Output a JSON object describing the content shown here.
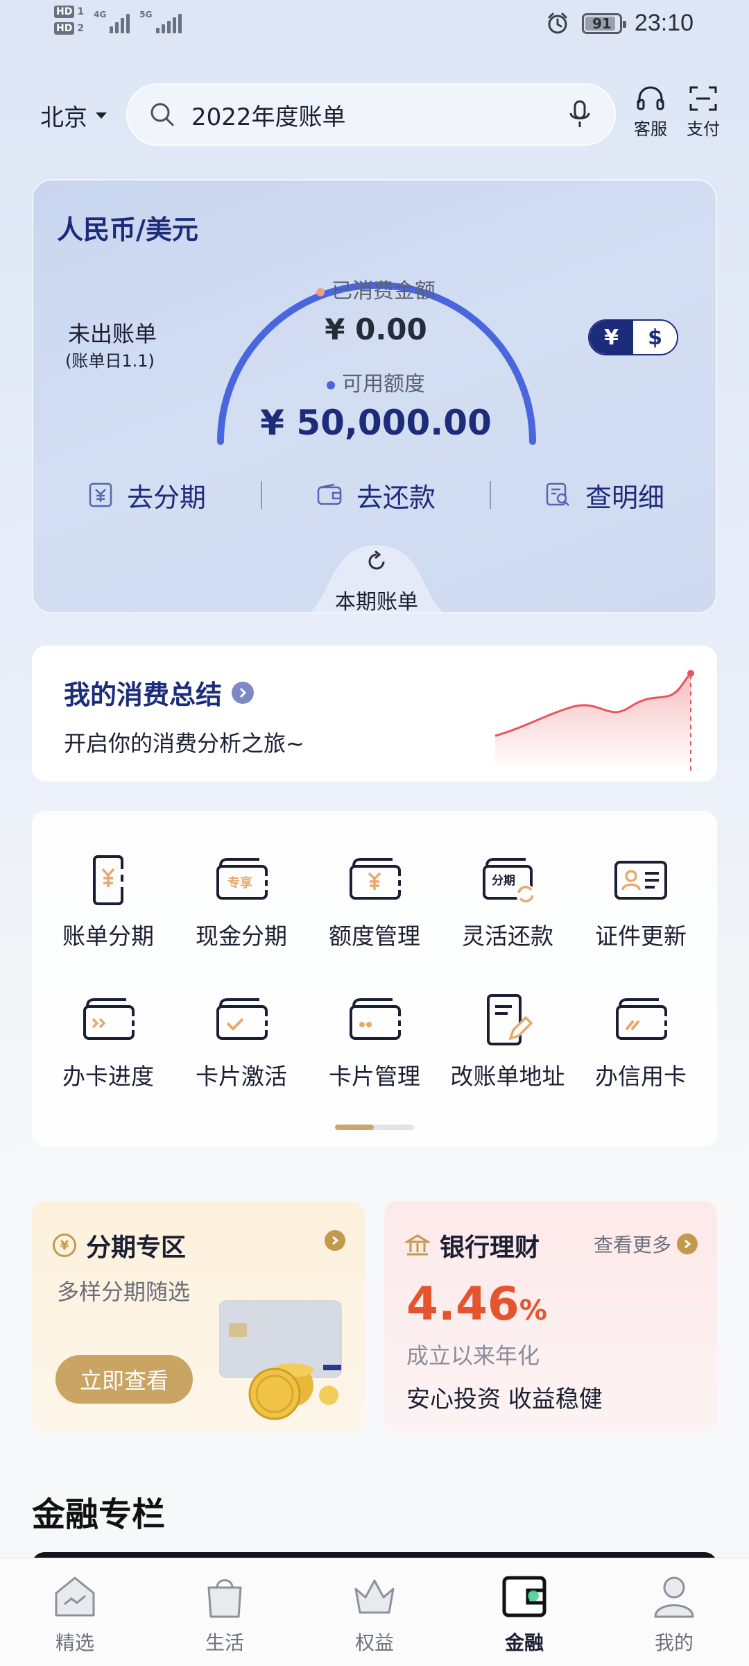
{
  "status_bar": {
    "sim1": "HD",
    "sim1_num": "1",
    "sim2": "HD",
    "sim2_num": "2",
    "net1": "4G",
    "net2": "5G",
    "battery": "91",
    "battery_level": 0.91,
    "time": "23:10"
  },
  "header": {
    "city": "北京",
    "search_placeholder": "2022年度账单",
    "service_label": "客服",
    "pay_label": "支付"
  },
  "credit_card": {
    "currency_title": "人民币/美元",
    "unbilled_label": "未出账单",
    "bill_day": "(账单日1.1)",
    "spent_label": "已消费金额",
    "spent_amount": "¥ 0.00",
    "available_label": "可用额度",
    "available_amount": "¥ 50,000.00",
    "toggle_cny": "¥",
    "toggle_usd": "$",
    "actions": {
      "installment": "去分期",
      "repay": "去还款",
      "details": "查明细"
    },
    "current_bill": "本期账单"
  },
  "summary": {
    "title": "我的消费总结",
    "subtitle": "开启你的消费分析之旅~"
  },
  "services": [
    {
      "label": "账单分期",
      "icon": "bill-installment-icon"
    },
    {
      "label": "现金分期",
      "icon": "cash-installment-icon"
    },
    {
      "label": "额度管理",
      "icon": "limit-management-icon"
    },
    {
      "label": "灵活还款",
      "icon": "flexible-repay-icon"
    },
    {
      "label": "证件更新",
      "icon": "id-update-icon"
    },
    {
      "label": "办卡进度",
      "icon": "card-progress-icon"
    },
    {
      "label": "卡片激活",
      "icon": "card-activate-icon"
    },
    {
      "label": "卡片管理",
      "icon": "card-management-icon"
    },
    {
      "label": "改账单地址",
      "icon": "bill-address-icon"
    },
    {
      "label": "办信用卡",
      "icon": "apply-card-icon"
    }
  ],
  "service_icon_texts": {
    "exclusive": "专享",
    "installment": "分期",
    "yuan": "¥"
  },
  "promo_installment": {
    "title": "分期专区",
    "subtitle": "多样分期随选",
    "cta": "立即查看"
  },
  "promo_wealth": {
    "title": "银行理财",
    "more": "查看更多",
    "rate": "4.46",
    "rate_unit": "%",
    "rate_label": "成立以来年化",
    "description": "安心投资 收益稳健"
  },
  "finance_column": {
    "title": "金融专栏"
  },
  "bottom_nav": [
    {
      "label": "精选",
      "icon": "home-icon"
    },
    {
      "label": "生活",
      "icon": "bag-icon"
    },
    {
      "label": "权益",
      "icon": "crown-icon"
    },
    {
      "label": "金融",
      "icon": "wallet-icon",
      "active": true
    },
    {
      "label": "我的",
      "icon": "profile-icon"
    }
  ],
  "colors": {
    "brand_navy": "#1d2c7a",
    "gauge_blue": "#4a66de",
    "accent_gold": "#c9a463",
    "rate_orange": "#e4542f",
    "active_green": "#3fcf8e"
  }
}
